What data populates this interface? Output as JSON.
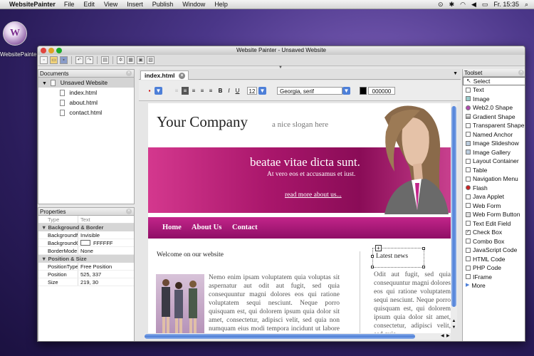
{
  "menubar": {
    "app_name": "WebsitePainter",
    "items": [
      "File",
      "Edit",
      "View",
      "Insert",
      "Publish",
      "Window",
      "Help"
    ],
    "clock": "Fr. 15:35"
  },
  "desktop": {
    "icon_label": "WebsitePainter"
  },
  "window": {
    "title": "Website Painter - Unsaved Website"
  },
  "documents": {
    "header": "Documents",
    "root": "Unsaved Website",
    "files": [
      "index.html",
      "about.html",
      "contact.html"
    ]
  },
  "properties": {
    "header": "Properties",
    "col_type": "Type",
    "col_value": "Text",
    "cat_background": "Background & Border",
    "cat_position": "Position & Size",
    "rows_bg": [
      {
        "k": "BackgroundMode",
        "v": "Invisible"
      },
      {
        "k": "BackgroundColor",
        "v": "FFFFFF"
      },
      {
        "k": "BorderMode",
        "v": "None"
      }
    ],
    "rows_pos": [
      {
        "k": "PositionType",
        "v": "Free Position"
      },
      {
        "k": "Position",
        "v": "525, 337"
      },
      {
        "k": "Size",
        "v": "219, 30"
      }
    ]
  },
  "editor": {
    "tab": "index.html",
    "font_size": "12",
    "font_family": "Georgia, serif",
    "color_value": "000000",
    "bold": "B",
    "italic": "I",
    "underline": "U"
  },
  "site": {
    "company": "Your Company",
    "slogan": "a nice slogan here",
    "banner_title": "beatae vitae dicta sunt.",
    "banner_sub": "At vero eos et accusamus et iust.",
    "banner_link": "read more about us...",
    "nav": [
      "Home",
      "About Us",
      "Contact"
    ],
    "welcome": "Welcome on our website",
    "latest": "Latest news",
    "lorem_main": "Nemo enim ipsam voluptatem quia voluptas sit aspernatur aut odit aut fugit, sed quia consequuntur magni dolores eos qui ratione voluptatem sequi nesciunt. Neque porro quisquam est, qui dolorem ipsum quia dolor sit amet, consectetur, adipisci velit, sed quia non numquam eius modi tempora incidunt ut labore et dolore magnam aliquam quaerat",
    "lorem_news": "Odit aut fugit, sed quia consequuntur magni dolores eos qui ratione voluptatem sequi nesciunt. Neque porro quisquam est, qui dolorem ipsum quia dolor sit amet, consectetur, adipisci velit, sed quia"
  },
  "toolset": {
    "header": "Toolset",
    "items": [
      "Select",
      "Text",
      "Image",
      "Web2.0 Shape",
      "Gradient Shape",
      "Transparent Shape",
      "Named Anchor",
      "Image Slideshow",
      "Image Gallery",
      "Layout Container",
      "Table",
      "Navigation Menu",
      "Flash",
      "Java Applet",
      "Web Form",
      "Web Form Button",
      "Text Edit Field",
      "Check Box",
      "Combo Box",
      "JavaScript Code",
      "HTML Code",
      "PHP Code",
      "IFrame",
      "More"
    ]
  },
  "colors": {
    "banner_magenta": "#a9166b",
    "nav_magenta": "#c2258a",
    "scroll_blue": "#4d7fd8"
  }
}
